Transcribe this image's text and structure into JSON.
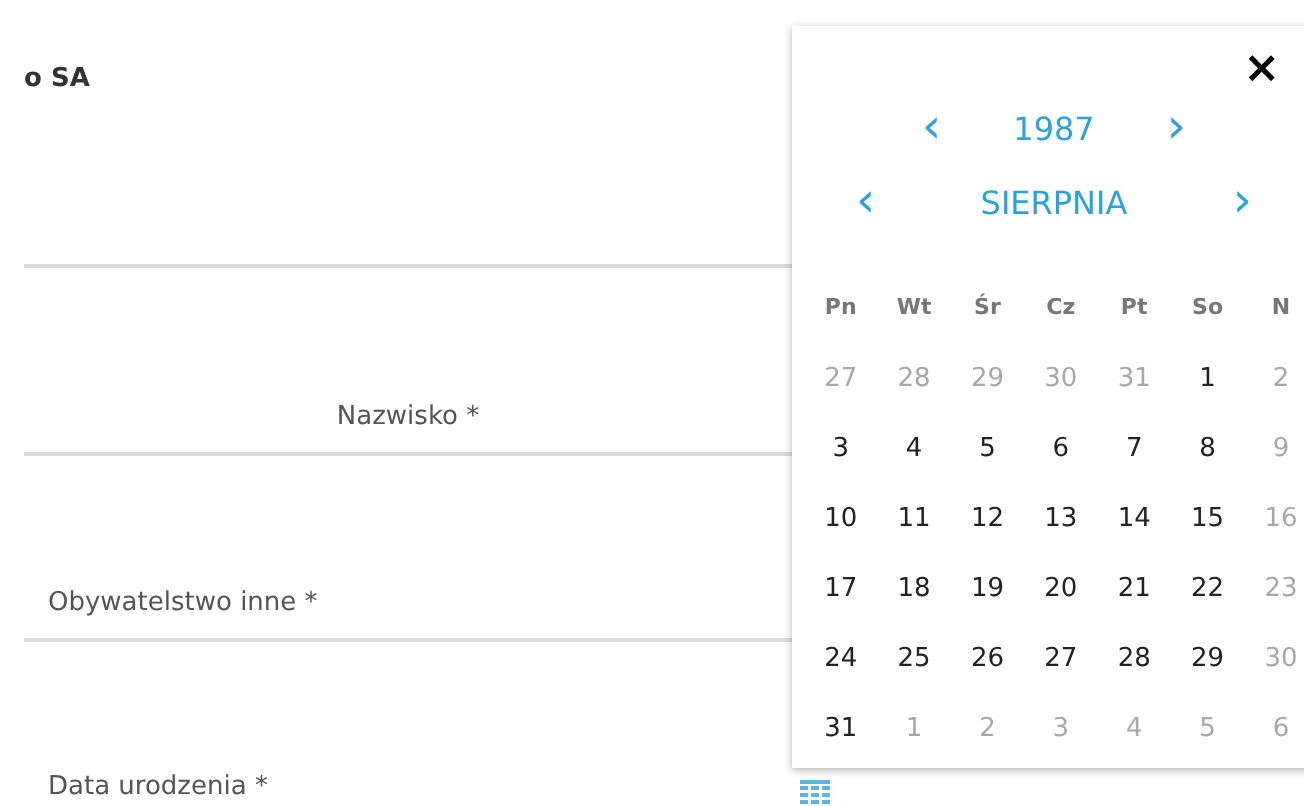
{
  "header": {
    "title": "o SA"
  },
  "fields": [
    {
      "label": "Nazwisko *",
      "kind": "centered"
    },
    {
      "label": "Obywatelstwo inne *",
      "kind": "left"
    },
    {
      "label": "Data urodzenia *",
      "kind": "date"
    }
  ],
  "datepicker": {
    "close": "×",
    "year": {
      "prev": "‹",
      "value": "1987",
      "next": "›"
    },
    "month": {
      "prev": "‹",
      "value": "SIERPNIA",
      "next": "›"
    },
    "weekdays": [
      "Pn",
      "Wt",
      "Śr",
      "Cz",
      "Pt",
      "So",
      "N"
    ],
    "weeks": [
      [
        {
          "day": "27",
          "disabled": true
        },
        {
          "day": "28",
          "disabled": true
        },
        {
          "day": "29",
          "disabled": true
        },
        {
          "day": "30",
          "disabled": true
        },
        {
          "day": "31",
          "disabled": true
        },
        {
          "day": "1",
          "disabled": false
        },
        {
          "day": "2",
          "disabled": true
        }
      ],
      [
        {
          "day": "3",
          "disabled": false
        },
        {
          "day": "4",
          "disabled": false
        },
        {
          "day": "5",
          "disabled": false
        },
        {
          "day": "6",
          "disabled": false
        },
        {
          "day": "7",
          "disabled": false
        },
        {
          "day": "8",
          "disabled": false
        },
        {
          "day": "9",
          "disabled": true
        }
      ],
      [
        {
          "day": "10",
          "disabled": false
        },
        {
          "day": "11",
          "disabled": false
        },
        {
          "day": "12",
          "disabled": false
        },
        {
          "day": "13",
          "disabled": false
        },
        {
          "day": "14",
          "disabled": false
        },
        {
          "day": "15",
          "disabled": false
        },
        {
          "day": "16",
          "disabled": true
        }
      ],
      [
        {
          "day": "17",
          "disabled": false
        },
        {
          "day": "18",
          "disabled": false
        },
        {
          "day": "19",
          "disabled": false
        },
        {
          "day": "20",
          "disabled": false
        },
        {
          "day": "21",
          "disabled": false
        },
        {
          "day": "22",
          "disabled": false
        },
        {
          "day": "23",
          "disabled": true
        }
      ],
      [
        {
          "day": "24",
          "disabled": false
        },
        {
          "day": "25",
          "disabled": false
        },
        {
          "day": "26",
          "disabled": false
        },
        {
          "day": "27",
          "disabled": false
        },
        {
          "day": "28",
          "disabled": false
        },
        {
          "day": "29",
          "disabled": false
        },
        {
          "day": "30",
          "disabled": true
        }
      ],
      [
        {
          "day": "31",
          "disabled": false
        },
        {
          "day": "1",
          "disabled": true
        },
        {
          "day": "2",
          "disabled": true
        },
        {
          "day": "3",
          "disabled": true
        },
        {
          "day": "4",
          "disabled": true
        },
        {
          "day": "5",
          "disabled": true
        },
        {
          "day": "6",
          "disabled": true
        }
      ]
    ]
  }
}
